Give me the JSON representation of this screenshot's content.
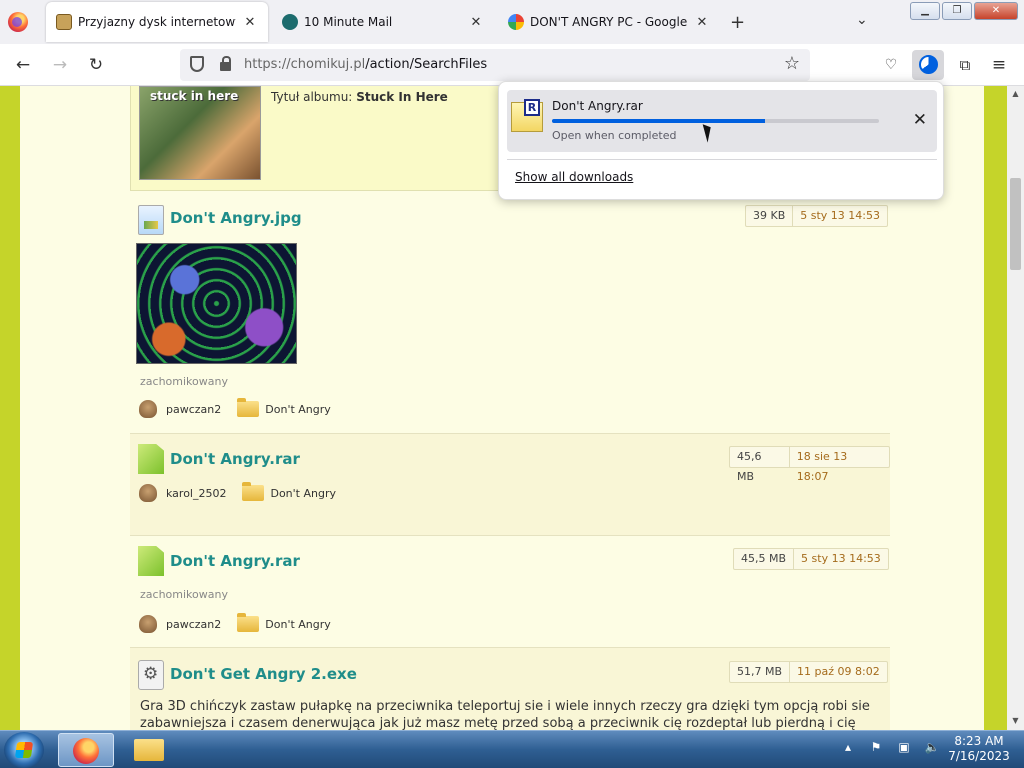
{
  "browser": {
    "tabs": [
      {
        "title": "Przyjazny dysk internetowy - Chomikuj.pl",
        "active": true
      },
      {
        "title": "10 Minute Mail",
        "active": false
      },
      {
        "title": "DON'T ANGRY PC - Google Search",
        "active": false
      }
    ],
    "url_host": "https://chomikuj.pl",
    "url_path": "/action/SearchFiles"
  },
  "downloads_panel": {
    "file_name": "Don't Angry.rar",
    "status": "Open when completed",
    "progress_percent": 65,
    "show_all_label": "Show all downloads",
    "icon_letter": "R"
  },
  "page": {
    "album": {
      "thumb_text": "stuck in here",
      "label_prefix": "Tytuł albumu:",
      "label_value": "Stuck In Here"
    },
    "files": [
      {
        "title": "Don't Angry.jpg",
        "size": "39 KB",
        "date": "5 sty 13 14:53",
        "status": "zachomikowany",
        "user": "pawczan2",
        "folder": "Don't Angry"
      },
      {
        "title": "Don't Angry.rar",
        "size": "45,6 MB",
        "date": "18 sie 13 18:07",
        "status": "",
        "user": "karol_2502",
        "folder": "Don't Angry"
      },
      {
        "title": "Don't Angry.rar",
        "size": "45,5 MB",
        "date": "5 sty 13 14:53",
        "status": "zachomikowany",
        "user": "pawczan2",
        "folder": "Don't Angry"
      },
      {
        "title": "Don't Get Angry 2.exe",
        "size": "51,7 MB",
        "date": "11 paź 09 8:02",
        "description": "Gra 3D chińczyk zastaw pułapkę na przeciwnika teleportuj sie i wiele innych rzeczy gra dzięki tym opcją robi sie zabawniejsza i czasem denerwująca jak już masz metę przed sobą a przeciwnik cię rozdeptał lub pierdną i cię"
      }
    ]
  },
  "taskbar": {
    "time": "8:23 AM",
    "date": "7/16/2023"
  },
  "colors": {
    "accent_blue": "#0060df",
    "file_title": "#1f8d8a",
    "page_background": "#fdfde4",
    "side_green": "#c5d42a"
  }
}
